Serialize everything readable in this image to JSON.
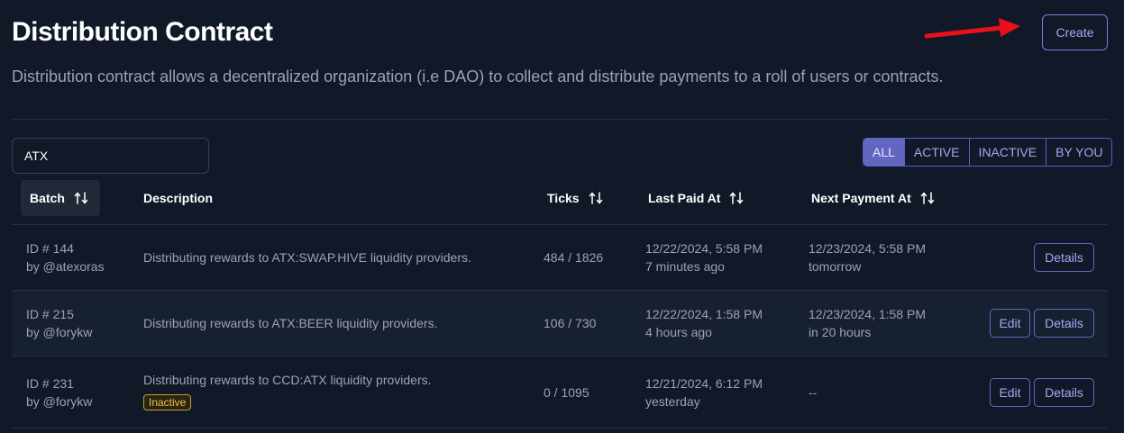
{
  "header": {
    "title": "Distribution Contract",
    "subtitle": "Distribution contract allows a decentralized organization (i.e DAO) to collect and distribute payments to a roll of users or contracts.",
    "create_label": "Create"
  },
  "search": {
    "value": "ATX"
  },
  "filters": [
    {
      "label": "ALL",
      "selected": true
    },
    {
      "label": "ACTIVE",
      "selected": false
    },
    {
      "label": "INACTIVE",
      "selected": false
    },
    {
      "label": "BY YOU",
      "selected": false
    }
  ],
  "columns": {
    "batch": "Batch",
    "description": "Description",
    "ticks": "Ticks",
    "last_paid": "Last Paid At",
    "next_payment": "Next Payment At"
  },
  "rows": [
    {
      "id": "ID # 144",
      "by": "by @atexoras",
      "description": "Distributing rewards to ATX:SWAP.HIVE liquidity providers.",
      "badge": "",
      "ticks": "484 / 1826",
      "last_paid": "12/22/2024, 5:58 PM",
      "last_paid_rel": "7 minutes ago",
      "next_payment": "12/23/2024, 5:58 PM",
      "next_payment_rel": "tomorrow",
      "edit_label": "",
      "details_label": "Details"
    },
    {
      "id": "ID # 215",
      "by": "by @forykw",
      "description": "Distributing rewards to ATX:BEER liquidity providers.",
      "badge": "",
      "ticks": "106 / 730",
      "last_paid": "12/22/2024, 1:58 PM",
      "last_paid_rel": "4 hours ago",
      "next_payment": "12/23/2024, 1:58 PM",
      "next_payment_rel": "in 20 hours",
      "edit_label": "Edit",
      "details_label": "Details"
    },
    {
      "id": "ID # 231",
      "by": "by @forykw",
      "description": "Distributing rewards to CCD:ATX liquidity providers.",
      "badge": "Inactive",
      "ticks": "0 / 1095",
      "last_paid": "12/21/2024, 6:12 PM",
      "last_paid_rel": "yesterday",
      "next_payment": "--",
      "next_payment_rel": "",
      "edit_label": "Edit",
      "details_label": "Details"
    }
  ],
  "colors": {
    "background": "#111827",
    "accent": "#6366c1",
    "annotation_arrow": "#e8101b",
    "inactive_badge": "#f2c14e"
  }
}
